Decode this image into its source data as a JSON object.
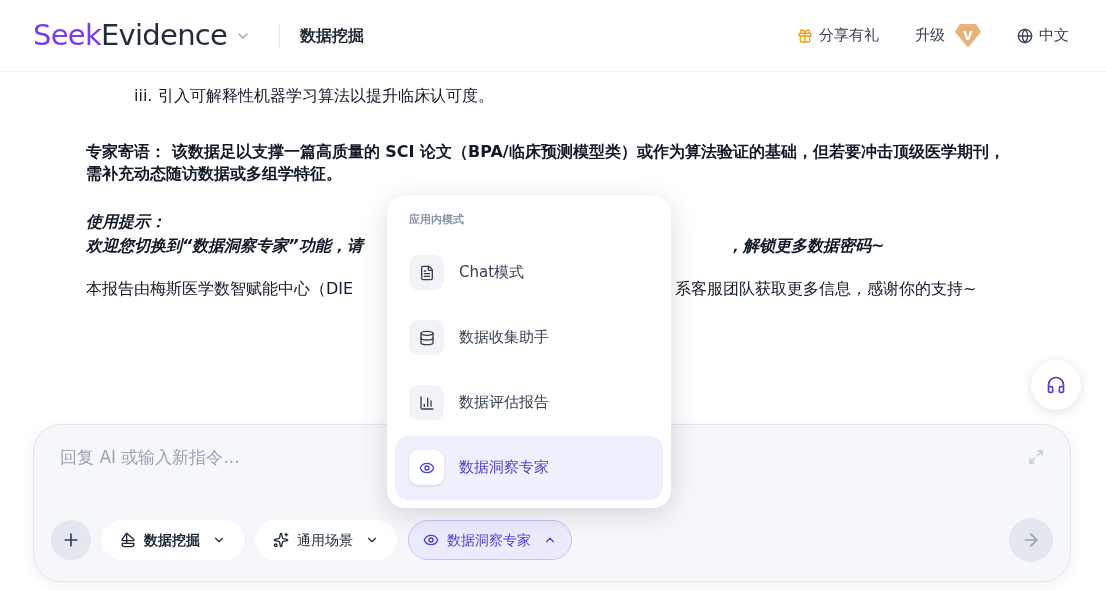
{
  "header": {
    "logo": {
      "part1": "Seek",
      "part2": "Evidence"
    },
    "page_title": "数据挖掘",
    "actions": [
      {
        "kind": "gift",
        "label": "分享有礼"
      },
      {
        "kind": "upgrade",
        "label": "升级",
        "badge": "V"
      },
      {
        "kind": "language",
        "label": "中文"
      }
    ]
  },
  "content": {
    "list_item": "iii. 引入可解释性机器学习算法以提升临床认可度。",
    "expert_note": "专家寄语： 该数据足以支撑一篇高质量的 SCI 论文（BPA/临床预测模型类）或作为算法验证的基础，但若要冲击顶级医学期刊，需补充动态随访数据或多组学特征。",
    "usage_title": "使用提示：",
    "usage_left": "欢迎您切换到“数据洞察专家”功能，请",
    "usage_right": "，解锁更多数据密码~",
    "report_left": "本报告由梅斯医学数智赋能中心（DIE",
    "report_right": "系客服团队获取更多信息，感谢你的支持~"
  },
  "mode_menu": {
    "heading": "应用内模式",
    "items": [
      {
        "kind": "document",
        "label": "Chat模式",
        "selected": false
      },
      {
        "kind": "database",
        "label": "数据收集助手",
        "selected": false
      },
      {
        "kind": "chart",
        "label": "数据评估报告",
        "selected": false
      },
      {
        "kind": "eye",
        "label": "数据洞察专家",
        "selected": true
      }
    ]
  },
  "composer": {
    "placeholder": "回复 AI 或输入新指令...",
    "chips": [
      {
        "kind": "mining",
        "label": "数据挖掘",
        "expanded": false
      },
      {
        "kind": "sparkle",
        "label": "通用场景",
        "expanded": false
      },
      {
        "kind": "eye",
        "label": "数据洞察专家",
        "expanded": true
      }
    ]
  }
}
